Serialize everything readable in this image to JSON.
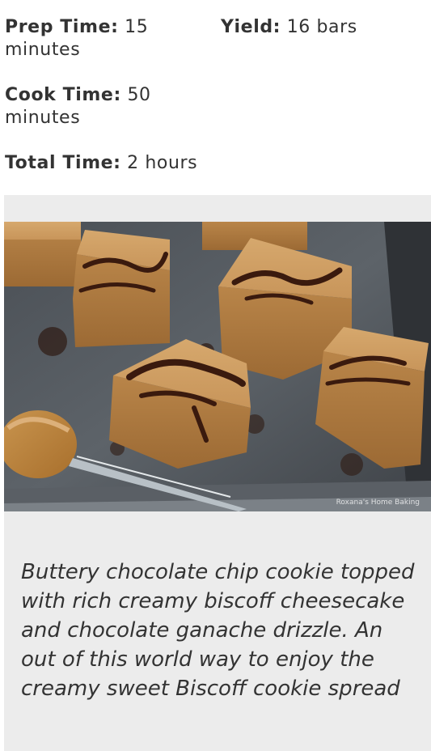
{
  "recipe_meta": {
    "prep_label": "Prep Time:",
    "prep_value": "15 minutes",
    "yield_label": "Yield:",
    "yield_value": "16 bars",
    "cook_label": "Cook Time:",
    "cook_value": "50 minutes",
    "total_label": "Total Time:",
    "total_value": "2 hours"
  },
  "photo": {
    "watermark": "Roxana's Home Baking"
  },
  "description": "Buttery chocolate chip cookie topped with rich creamy biscoff cheesecake and chocolate ganache drizzle. An out of this world way to enjoy the creamy sweet Biscoff cookie spread",
  "colors": {
    "card_background": "#ececec",
    "text": "#333333"
  }
}
